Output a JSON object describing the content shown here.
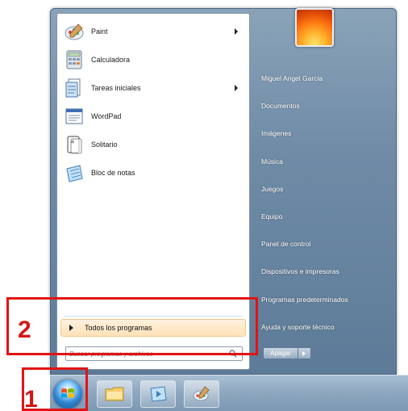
{
  "start_menu": {
    "programs": [
      {
        "label": "Paint",
        "icon": "paint-icon",
        "has_submenu": true
      },
      {
        "label": "Calculadora",
        "icon": "calculator-icon",
        "has_submenu": false
      },
      {
        "label": "Tareas iniciales",
        "icon": "getting-started-icon",
        "has_submenu": true
      },
      {
        "label": "WordPad",
        "icon": "wordpad-icon",
        "has_submenu": false
      },
      {
        "label": "Solitario",
        "icon": "solitaire-icon",
        "has_submenu": false
      },
      {
        "label": "Bloc de notas",
        "icon": "notepad-icon",
        "has_submenu": false
      }
    ],
    "all_programs_label": "Todos los programas",
    "search_placeholder": "Buscar programas y archivos",
    "right_items": [
      "Miguel Angel Garcia",
      "Documentos",
      "Imágenes",
      "Música",
      "Juegos",
      "Equipo",
      "Panel de control",
      "Dispositivos e impresoras",
      "Programas predeterminados",
      "Ayuda y soporte técnico"
    ],
    "shutdown_label": "Apagar"
  },
  "taskbar": {
    "start_button": "windows-start-orb",
    "pinned": [
      "explorer-folder-icon",
      "media-player-icon",
      "paint-taskbar-icon"
    ]
  },
  "annotations": {
    "one": "1",
    "two": "2",
    "color": "#e21313"
  },
  "colors": {
    "highlight": "#ffe1b8",
    "menu_frame": "#6f8ba6",
    "taskbar": "#8ca6bf"
  }
}
